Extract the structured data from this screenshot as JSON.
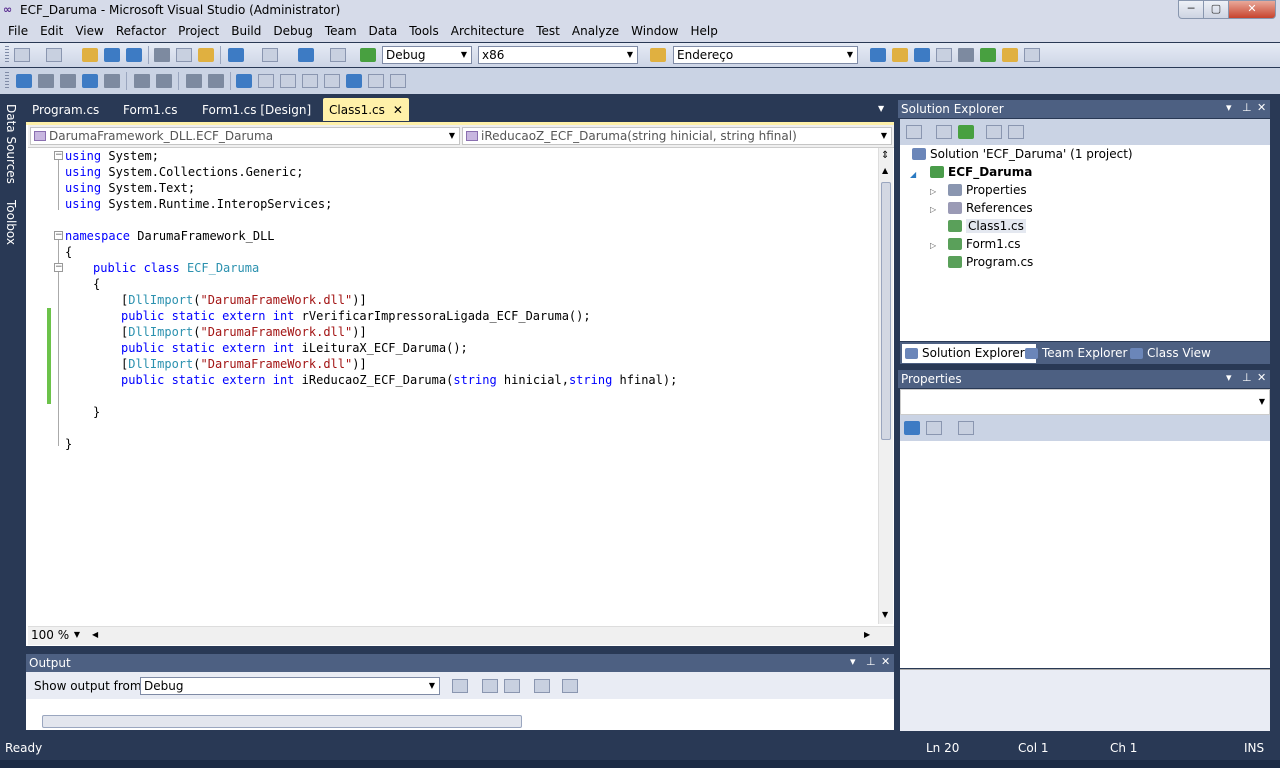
{
  "window": {
    "title": "ECF_Daruma - Microsoft Visual Studio (Administrator)",
    "minimize": "─",
    "maximize": "▢",
    "close": "✕"
  },
  "menu": [
    "File",
    "Edit",
    "View",
    "Refactor",
    "Project",
    "Build",
    "Debug",
    "Team",
    "Data",
    "Tools",
    "Architecture",
    "Test",
    "Analyze",
    "Window",
    "Help"
  ],
  "toolbar": {
    "config": "Debug",
    "platform": "x86",
    "find_combo": "Endereço"
  },
  "side_tabs": [
    "Data Sources",
    "Toolbox"
  ],
  "doc_tabs": [
    {
      "label": "Program.cs"
    },
    {
      "label": "Form1.cs"
    },
    {
      "label": "Form1.cs [Design]"
    },
    {
      "label": "Class1.cs",
      "close": "✕"
    }
  ],
  "nav": {
    "type": "DarumaFramework_DLL.ECF_Daruma",
    "member": "iReducaoZ_ECF_Daruma(string hinicial, string hfinal)"
  },
  "code": {
    "l1": {
      "kw": "using",
      "rest": " System;"
    },
    "l2": {
      "kw": "using",
      "rest": " System.Collections.Generic;"
    },
    "l3": {
      "kw": "using",
      "rest": " System.Text;"
    },
    "l4": {
      "kw": "using",
      "rest": " System.Runtime.InteropServices;"
    },
    "l6": {
      "kw": "namespace",
      "rest": " DarumaFramework_DLL"
    },
    "l7": "{",
    "l8": {
      "kw": "public class",
      "ty": "ECF_Daruma"
    },
    "l9": "{",
    "attr_open": "[",
    "attr_type": "DllImport",
    "attr_str": "\"DarumaFrameWork.dll\"",
    "attr_close": ")]",
    "paren_open": "(",
    "m_kw": "public static extern int",
    "m1": " rVerificarImpressoraLigada_ECF_Daruma();",
    "m2": " iLeituraX_ECF_Daruma();",
    "m3_name": " iReducaoZ_ECF_Daruma(",
    "m3_kw": "string",
    "m3_p1": " hinicial,",
    "m3_p2": " hfinal);",
    "close_class": "}",
    "close_ns": "}"
  },
  "zoom": "100 %",
  "output": {
    "title": "Output",
    "show_from_label": "Show output from:",
    "show_from_value": "Debug"
  },
  "solution_explorer": {
    "title": "Solution Explorer",
    "solution": "Solution 'ECF_Daruma' (1 project)",
    "project": "ECF_Daruma",
    "items": [
      "Properties",
      "References",
      "Class1.cs",
      "Form1.cs",
      "Program.cs"
    ],
    "tabs": [
      "Solution Explorer",
      "Team Explorer",
      "Class View"
    ]
  },
  "properties": {
    "title": "Properties"
  },
  "status": {
    "text": "Ready",
    "ln": "Ln 20",
    "col": "Col 1",
    "ch": "Ch 1",
    "mode": "INS"
  }
}
